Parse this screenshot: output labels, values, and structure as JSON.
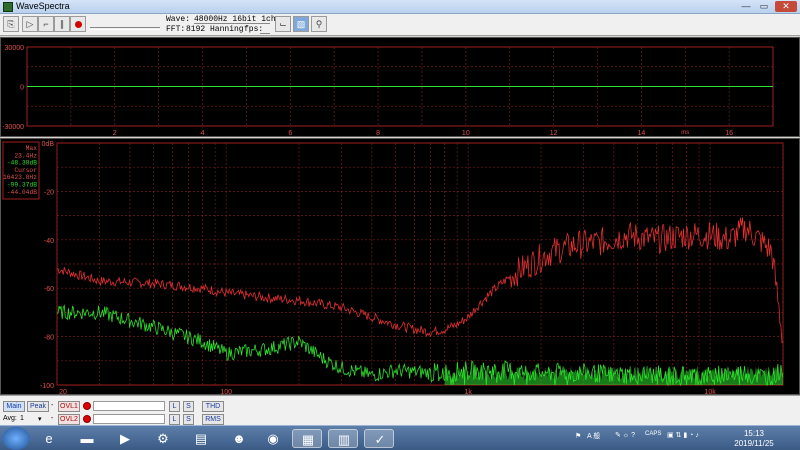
{
  "window": {
    "title": "WaveSpectra",
    "minimize": "—",
    "maximize": "▭",
    "close": "✕"
  },
  "toolbar": {
    "wave_label": "Wave:",
    "wave_value": "48000Hz 16bit 1ch",
    "fft_label": "FFT:",
    "fft_value": "8192 Hanning",
    "fps_label": "fps:"
  },
  "waveform": {
    "y_ticks": [
      "30000",
      "0",
      "-30000"
    ],
    "x_ticks": [
      "2",
      "4",
      "6",
      "8",
      "10",
      "12",
      "14",
      "16"
    ],
    "x_unit": "ms"
  },
  "spectrum": {
    "y_ticks": [
      "0dB",
      "-20",
      "-40",
      "-60",
      "-80",
      "-100"
    ],
    "x_ticks": [
      "20",
      "100",
      "1k",
      "10k"
    ],
    "info": {
      "max_label": "Max",
      "max_freq": "23.4Hz",
      "max_db": "-48.38dB",
      "cursor_label": "Cursor",
      "cursor_freq": "16423.8Hz",
      "cursor_db1": "-99.37dB",
      "cursor_db2": "-44.04dB"
    },
    "colors": {
      "ch_red": "#e03030",
      "ch_green": "#2ee02e",
      "grid": "#7a1a1a"
    }
  },
  "chart_data": {
    "type": "line",
    "x_scale": "log",
    "xlim": [
      20,
      20000
    ],
    "ylim": [
      -100,
      0
    ],
    "series": [
      {
        "color": "#e03030",
        "x": [
          20,
          30,
          50,
          80,
          100,
          150,
          200,
          300,
          400,
          500,
          600,
          700,
          800,
          900,
          1000,
          1100,
          1300,
          1500,
          1800,
          2200,
          2800,
          3500,
          4500,
          6000,
          8000,
          10000,
          12000,
          14000,
          16000,
          18000,
          20000
        ],
        "y": [
          -52,
          -57,
          -58,
          -60,
          -62,
          -64,
          -65,
          -68,
          -72,
          -75,
          -77,
          -78,
          -77,
          -75,
          -72,
          -67,
          -60,
          -55,
          -50,
          -45,
          -42,
          -41,
          -38,
          -40,
          -38,
          -38,
          -40,
          -35,
          -40,
          -45,
          -82
        ]
      },
      {
        "color": "#2ee02e",
        "x": [
          20,
          30,
          50,
          80,
          100,
          150,
          200,
          250,
          300,
          400,
          500,
          700,
          1000,
          1500,
          2000,
          3000,
          5000,
          8000,
          10000,
          14000,
          16000,
          18000,
          20000
        ],
        "y": [
          -70,
          -70,
          -76,
          -82,
          -87,
          -85,
          -82,
          -89,
          -93,
          -96,
          -94,
          -95,
          -94,
          -94,
          -95,
          -95,
          -96,
          -96,
          -96,
          -95,
          -96,
          -97,
          -93
        ]
      }
    ]
  },
  "bottom": {
    "main_btn": "Main",
    "peak_btn": "Peak",
    "ovl1_btn": "OVL1",
    "ovl2_btn": "OVL2",
    "avg_label": "Avg:",
    "avg_value": "1",
    "l1": "L",
    "s1": "S",
    "l2": "L",
    "s2": "S",
    "thd_btn": "THD",
    "rms_btn": "RMS"
  },
  "taskbar": {
    "time": "15:13",
    "date": "2019/11/25",
    "tray_ime": "A 般",
    "tray_caps": "CAPS"
  }
}
